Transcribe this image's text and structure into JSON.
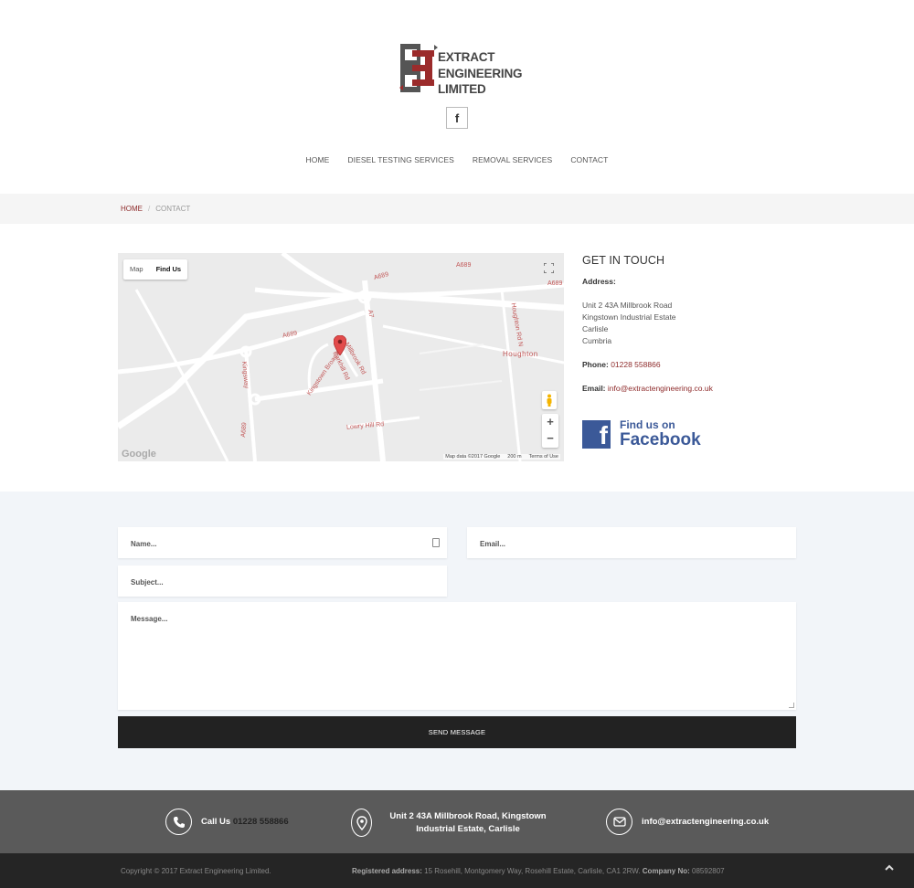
{
  "brand": {
    "line1": "EXTRACT",
    "line2": "ENGINEERING",
    "line3": "LIMITED"
  },
  "social": {
    "facebook_glyph": "f"
  },
  "nav": {
    "items": [
      {
        "label": "HOME"
      },
      {
        "label": "DIESEL TESTING SERVICES"
      },
      {
        "label": "REMOVAL SERVICES"
      },
      {
        "label": "CONTACT"
      }
    ]
  },
  "breadcrumb": {
    "home": "HOME",
    "separator": "/",
    "current": "CONTACT"
  },
  "map": {
    "toggle_map": "Map",
    "toggle_findus": "Find Us",
    "zoom_in": "+",
    "zoom_out": "−",
    "footer_data": "Map data ©2017 Google",
    "footer_scale": "200 m",
    "footer_terms": "Terms of Use",
    "google": "Google",
    "labels": {
      "a689_1": "A689",
      "a689_2": "A689",
      "a689_3": "A689",
      "a689_4": "A689",
      "a689_5": "A689",
      "a7": "A7",
      "houghton": "Houghton",
      "houghton_rd": "Houghton Rd N",
      "kingsway": "Kingsway",
      "broadway": "Kingstown Broadway",
      "parkhill": "Parkhill Rd",
      "millbrook": "Millbrook Rd",
      "lowry": "Lowry Hill Rd"
    }
  },
  "contact": {
    "title": "GET IN TOUCH",
    "address_label": "Address:",
    "address_lines": [
      "Unit 2 43A Millbrook Road",
      "Kingstown Industrial Estate",
      "Carlisle",
      "Cumbria"
    ],
    "phone_label": "Phone:",
    "phone": "01228 558866",
    "email_label": "Email:",
    "email": "info@extractengineering.co.uk",
    "fb_find": "Find us on",
    "fb_name": "Facebook",
    "fb_glyph": "f"
  },
  "form": {
    "name_placeholder": "Name...",
    "email_placeholder": "Email...",
    "subject_placeholder": "Subject...",
    "message_placeholder": "Message...",
    "send_label": "SEND MESSAGE"
  },
  "footer": {
    "call_label": "Call Us",
    "call_number": "01228 558866",
    "address_line1": "Unit 2 43A Millbrook Road, Kingstown",
    "address_line2": "Industrial Estate, Carlisle",
    "email": "info@extractengineering.co.uk",
    "copyright": "Copyright © 2017 Extract Engineering Limited.",
    "reg_label": "Registered address:",
    "reg_address": "15 Rosehill, Montgomery Way, Rosehill Estate, Carlisle, CA1 2RW.",
    "company_label": "Company No:",
    "company_no": "08592807",
    "to_top": "⌃"
  },
  "colors": {
    "accent": "#8e2b2b",
    "dark": "#222222",
    "footer_top": "#5a5a5a",
    "footer_bottom": "#252525",
    "facebook": "#3b5998"
  }
}
